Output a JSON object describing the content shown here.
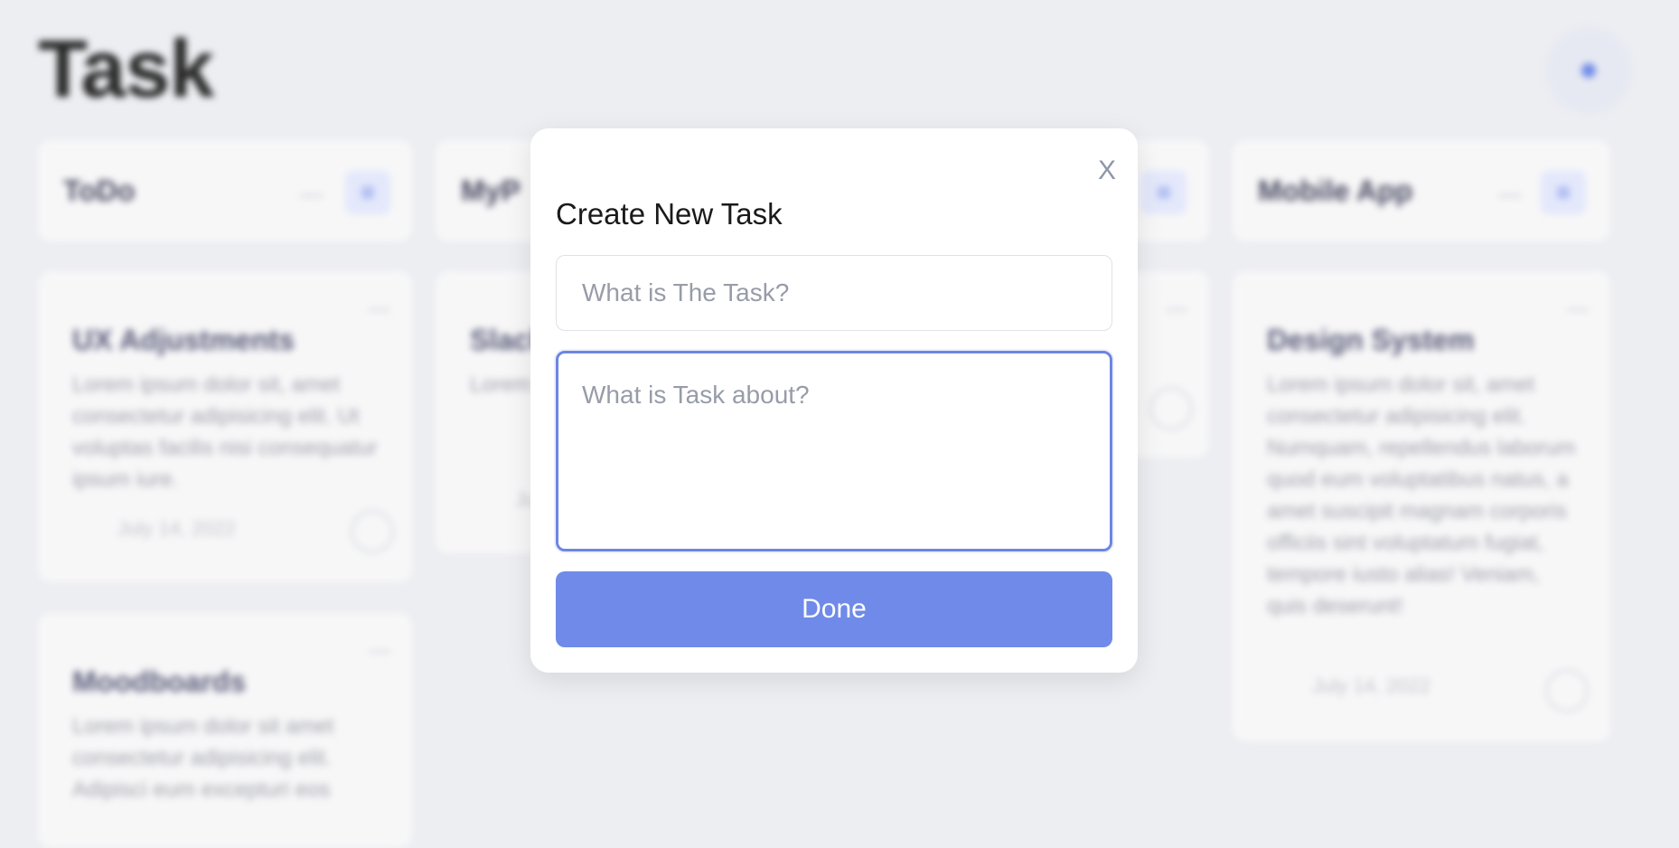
{
  "board": {
    "title": "Task",
    "columns": [
      {
        "name": "ToDo"
      },
      {
        "name": "MyP"
      },
      {
        "name": ""
      },
      {
        "name": "Mobile App"
      }
    ],
    "cards": [
      {
        "title": "UX Adjustments",
        "body": "Lorem ipsum dolor sit, amet consectetur adipisicing elit. Ut voluptas facilis nisi consequatur ipsum iure.",
        "date": "July 14, 2022"
      },
      {
        "title": "Moodboards",
        "body": "Lorem ipsum dolor sit amet consectetur adipisicing elit. Adipisci eum excepturi eos"
      },
      {
        "title": "Slack",
        "body": "Lorem consectetur adipisicing elit. Molestias",
        "date": "July"
      },
      {
        "title": "Design System",
        "body": "Lorem ipsum dolor sit, amet consectetur adipisicing elit. Numquam, repellendus laborum quod eum voluptatibus natus, a amet suscipit magnam corporis officiis sint voluptatum fugiat, tempore iusto alias! Veniam, quis deserunt!",
        "date": "July 14, 2022"
      }
    ],
    "menu_glyph": "—",
    "colors": {
      "accent": "#6f8ae8",
      "background": "#edeef2"
    }
  },
  "modal": {
    "close_label": "X",
    "title": "Create New Task",
    "task_placeholder": "What is The Task?",
    "about_placeholder": "What is Task about?",
    "done_label": "Done"
  }
}
